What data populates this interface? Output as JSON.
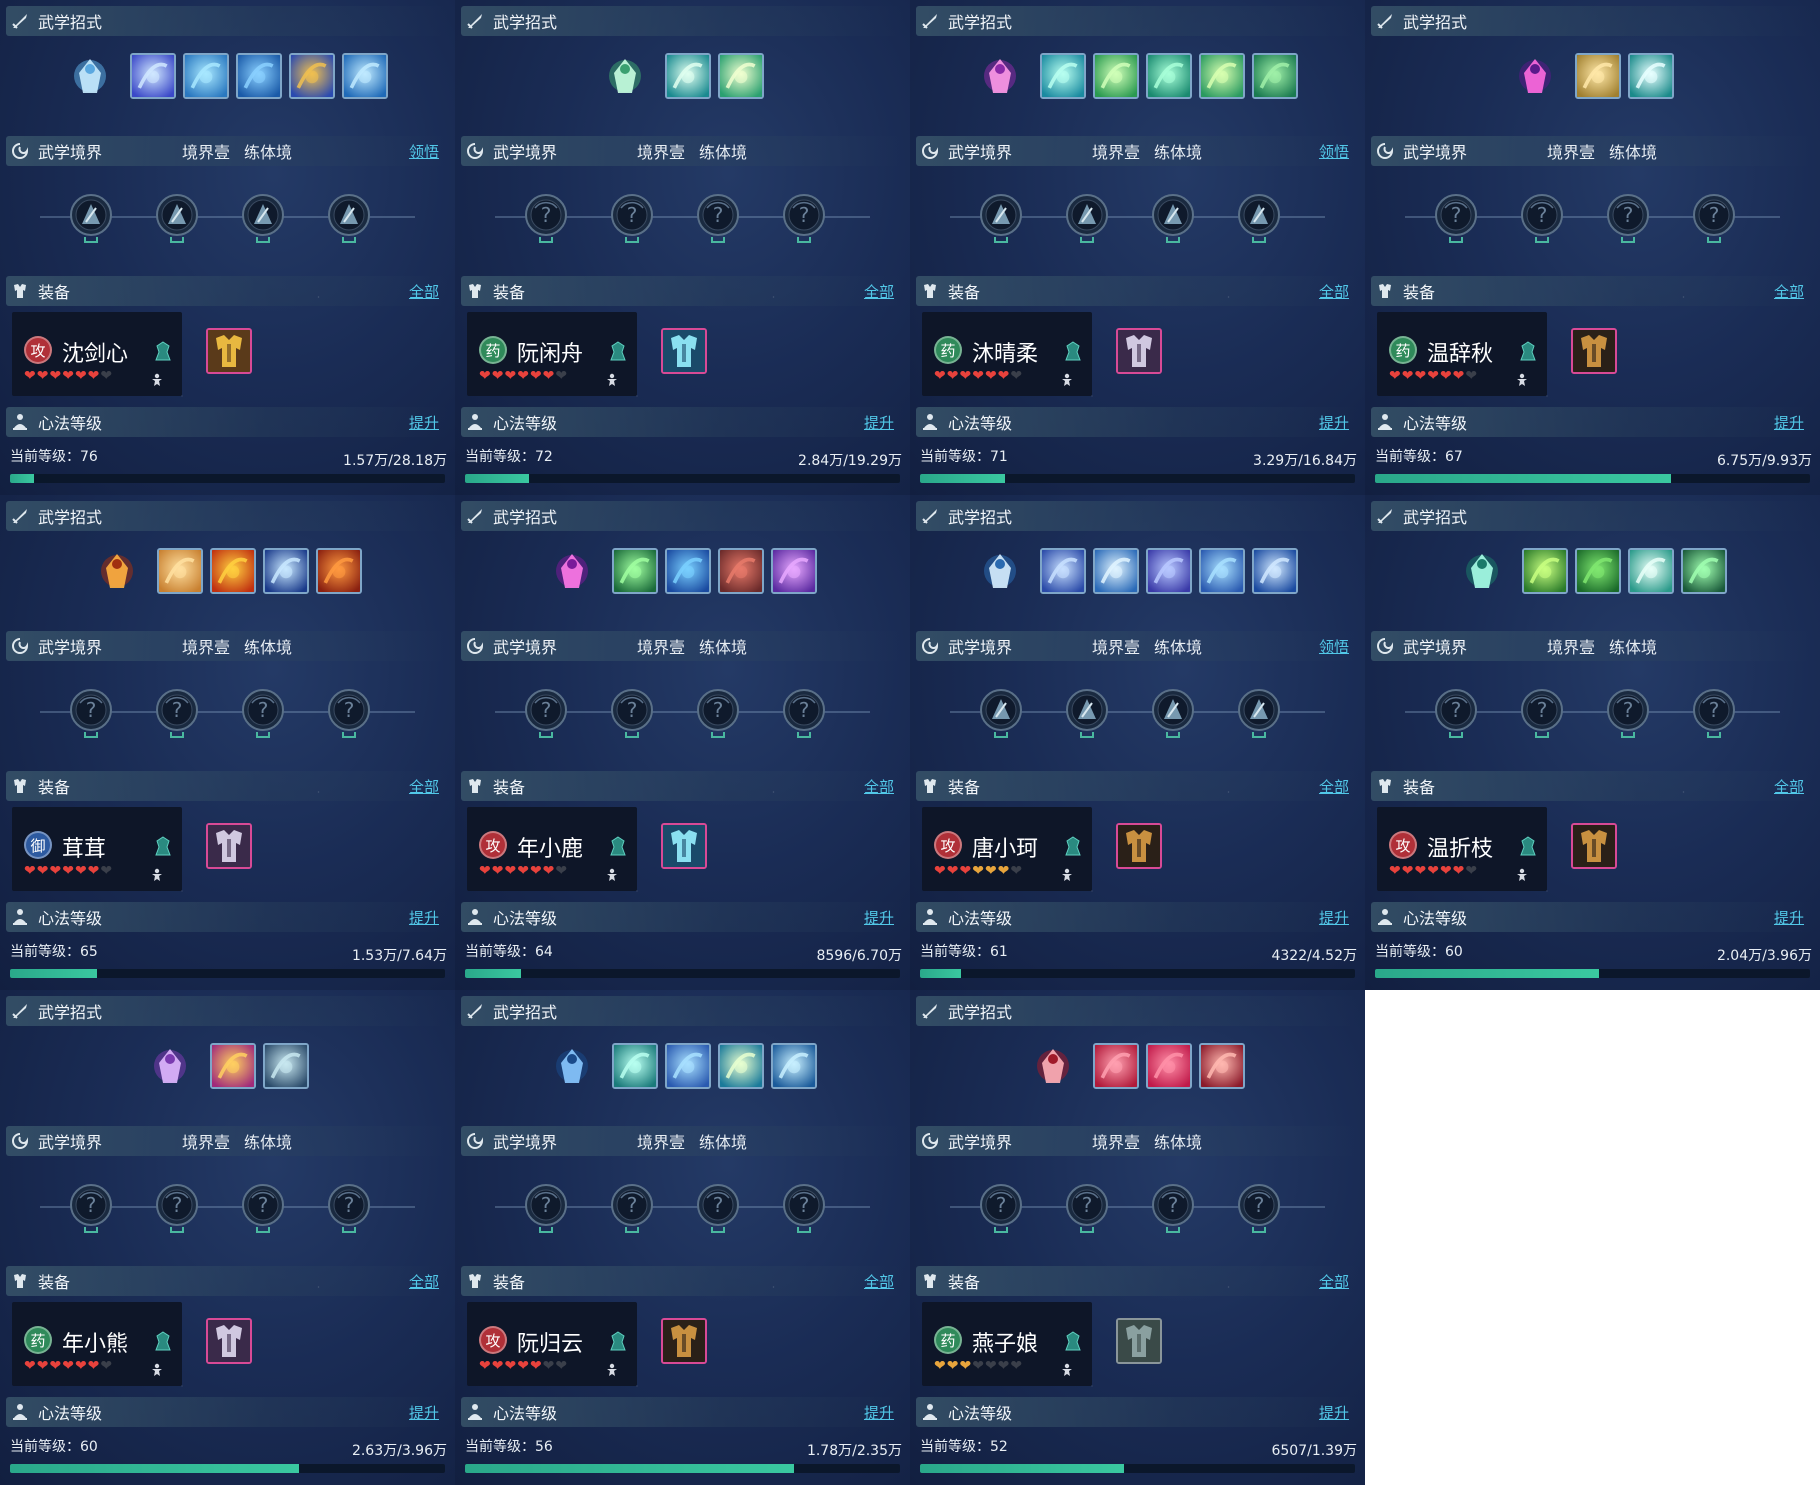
{
  "labels": {
    "skills_title": "武学招式",
    "realm_title": "武学境界",
    "realm_level": "境界壹",
    "realm_stage": "练体境",
    "realm_link": "领悟",
    "equip_title": "装备",
    "equip_link": "全部",
    "heart_title": "心法等级",
    "heart_link": "提升",
    "level_prefix": "当前等级："
  },
  "colors": {
    "accent": "#52c8e8",
    "exp_bar": "#3ac8a0",
    "badge_attack": "#b03038",
    "badge_heal": "#2f8a5a",
    "badge_defense": "#2d5aa0"
  },
  "panels": [
    {
      "name": "沈剑心",
      "role": "攻",
      "role_type": "attack",
      "hearts_full": 6,
      "hearts_orange": 0,
      "hearts_total": 7,
      "level": "76",
      "exp": "1.57万/28.18万",
      "exp_fraction": 0.056,
      "has_realm_link": true,
      "skills": [
        "spiral-ice",
        "lightning-blade",
        "water-vortex",
        "ice-wing",
        "fish-spear",
        "wave-dagger"
      ],
      "realm_nodes": [
        "fan-blade",
        "vortex",
        "sword",
        "spear"
      ],
      "equip": "armor-gold",
      "equip_frame": "pink"
    },
    {
      "name": "阮闲舟",
      "role": "药",
      "role_type": "heal",
      "hearts_full": 6,
      "hearts_orange": 0,
      "hearts_total": 7,
      "level": "72",
      "exp": "2.84万/19.29万",
      "exp_fraction": 0.147,
      "has_realm_link": false,
      "skills": [
        "green-orb",
        "butterfly-cup",
        "sun-flower"
      ],
      "realm_nodes": [
        "locked",
        "locked",
        "locked",
        "locked"
      ],
      "equip": "armor-blue",
      "equip_frame": "pink"
    },
    {
      "name": "沐晴柔",
      "role": "药",
      "role_type": "heal",
      "hearts_full": 6,
      "hearts_orange": 0,
      "hearts_total": 7,
      "level": "71",
      "exp": "3.29万/16.84万",
      "exp_fraction": 0.195,
      "has_realm_link": true,
      "skills": [
        "purple-dancer",
        "wind-bird",
        "leaf-swirl",
        "green-vortex",
        "jade-swirl",
        "green-dragon"
      ],
      "realm_nodes": [
        "lotus",
        "moon",
        "hat",
        "altar"
      ],
      "equip": "armor-silver",
      "equip_frame": "pink"
    },
    {
      "name": "温辞秋",
      "role": "药",
      "role_type": "heal",
      "hearts_full": 6,
      "hearts_orange": 0,
      "hearts_total": 7,
      "level": "67",
      "exp": "6.75万/9.93万",
      "exp_fraction": 0.68,
      "has_realm_link": false,
      "skills": [
        "violet-star",
        "golden-wings",
        "sun-disk"
      ],
      "realm_nodes": [
        "locked",
        "locked",
        "locked",
        "locked"
      ],
      "equip": "armor-dark",
      "equip_frame": "pink"
    },
    {
      "name": "茸茸",
      "role": "御",
      "role_type": "defense",
      "hearts_full": 6,
      "hearts_orange": 0,
      "hearts_total": 7,
      "level": "65",
      "exp": "1.53万/7.64万",
      "exp_fraction": 0.2,
      "has_realm_link": false,
      "skills": [
        "fire-man",
        "golden-buddha",
        "red-sun",
        "blue-crescent",
        "fire-whirl"
      ],
      "realm_nodes": [
        "locked",
        "locked",
        "locked",
        "locked"
      ],
      "equip": "armor-silver",
      "equip_frame": "pink"
    },
    {
      "name": "年小鹿",
      "role": "攻",
      "role_type": "attack",
      "hearts_full": 6,
      "hearts_orange": 0,
      "hearts_total": 7,
      "level": "64",
      "exp": "8596/6.70万",
      "exp_fraction": 0.128,
      "has_realm_link": false,
      "skills": [
        "purple-flame",
        "green-sword",
        "blue-dragon",
        "red-maple",
        "violet-spirit"
      ],
      "realm_nodes": [
        "locked",
        "locked",
        "locked",
        "locked"
      ],
      "equip": "armor-blue",
      "equip_frame": "pink"
    },
    {
      "name": "唐小珂",
      "role": "攻",
      "role_type": "attack",
      "hearts_full": 3,
      "hearts_orange": 3,
      "hearts_total": 7,
      "level": "61",
      "exp": "4322/4.52万",
      "exp_fraction": 0.095,
      "has_realm_link": true,
      "skills": [
        "blue-wing",
        "blue-warrior",
        "ice-bolt",
        "bow-strike",
        "blue-swirl",
        "blue-dancer"
      ],
      "realm_nodes": [
        "crossbow",
        "arrow",
        "lock-cross",
        "cannon"
      ],
      "equip": "armor-dark",
      "equip_frame": "pink"
    },
    {
      "name": "温折枝",
      "role": "攻",
      "role_type": "attack",
      "hearts_full": 6,
      "hearts_orange": 0,
      "hearts_total": 7,
      "level": "60",
      "exp": "2.04万/3.96万",
      "exp_fraction": 0.515,
      "has_realm_link": false,
      "skills": [
        "jade-dancer",
        "leaf-dart",
        "green-slash",
        "ripple",
        "yin-yang"
      ],
      "realm_nodes": [
        "locked",
        "locked",
        "locked",
        "locked"
      ],
      "equip": "armor-dark",
      "equip_frame": "pink"
    },
    {
      "name": "年小熊",
      "role": "药",
      "role_type": "heal",
      "hearts_full": 6,
      "hearts_orange": 0,
      "hearts_total": 7,
      "level": "60",
      "exp": "2.63万/3.96万",
      "exp_fraction": 0.664,
      "has_realm_link": false,
      "skills": [
        "violet-cone",
        "pink-eye",
        "spike-fish"
      ],
      "realm_nodes": [
        "locked",
        "locked",
        "locked",
        "locked"
      ],
      "equip": "armor-silver",
      "equip_frame": "pink"
    },
    {
      "name": "阮归云",
      "role": "攻",
      "role_type": "attack",
      "hearts_full": 5,
      "hearts_orange": 0,
      "hearts_total": 7,
      "level": "56",
      "exp": "1.78万/2.35万",
      "exp_fraction": 0.757,
      "has_realm_link": false,
      "skills": [
        "blue-rose",
        "teal-wave",
        "blue-swirl",
        "cyan-flower",
        "aqua-wave"
      ],
      "realm_nodes": [
        "locked",
        "locked",
        "locked",
        "locked"
      ],
      "equip": "armor-dark",
      "equip_frame": "pink"
    },
    {
      "name": "燕子娘",
      "role": "药",
      "role_type": "heal",
      "hearts_full": 0,
      "hearts_orange": 3,
      "hearts_total": 7,
      "level": "52",
      "exp": "6507/1.39万",
      "exp_fraction": 0.468,
      "has_realm_link": false,
      "skills": [
        "red-slash",
        "red-claw",
        "red-rose",
        "crimson-warrior"
      ],
      "realm_nodes": [
        "locked",
        "locked",
        "locked",
        "locked"
      ],
      "equip": "robe-gray",
      "equip_frame": "gray"
    }
  ]
}
